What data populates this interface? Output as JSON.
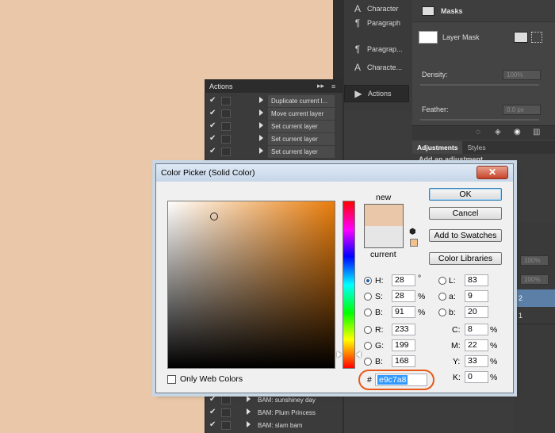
{
  "colors": {
    "background": "#e9c7a8",
    "new_color": "#e9c7a8",
    "current_color": "#e6e6e6",
    "accent_ring": "#e85a1c"
  },
  "ps_mid_panel": [
    {
      "icon": "A",
      "label": "Character"
    },
    {
      "icon": "¶",
      "label": "Paragraph"
    },
    {
      "icon": "¶",
      "label": "Paragrap..."
    },
    {
      "icon": "A",
      "label": "Characte..."
    },
    {
      "icon": "▶",
      "label": "Actions"
    }
  ],
  "masks": {
    "title": "Masks",
    "layer_mask": "Layer Mask",
    "density_label": "Density:",
    "density_value": "100%",
    "feather_label": "Feather:",
    "feather_value": "0.0 px"
  },
  "adjustments": {
    "tab1": "Adjustments",
    "tab2": "Styles",
    "hint": "Add an adjustment"
  },
  "layers_right": {
    "opacity1": "100%",
    "opacity2": "100%",
    "row1": "2",
    "row2": "1"
  },
  "actions_panel": {
    "title": "Actions",
    "top_rows": [
      "Duplicate current l...",
      "Move current layer",
      "Set current layer",
      "Set current layer",
      "Set current layer"
    ],
    "bottom_rows": [
      "BAM: sunshiney day",
      "BAM: Plum Princess",
      "BAM: slam bam"
    ]
  },
  "dialog": {
    "title": "Color Picker (Solid Color)",
    "close": "✕",
    "new_label": "new",
    "current_label": "current",
    "buttons": {
      "ok": "OK",
      "cancel": "Cancel",
      "add_swatches": "Add to Swatches",
      "libraries": "Color Libraries"
    },
    "hsb": {
      "h": "28",
      "s": "28",
      "b": "91",
      "h_unit": "°",
      "s_unit": "%",
      "b_unit": "%"
    },
    "rgb": {
      "r": "233",
      "g": "199",
      "b": "168"
    },
    "lab": {
      "l": "83",
      "a": "9",
      "b": "20"
    },
    "cmyk": {
      "c": "8",
      "m": "22",
      "y": "33",
      "k": "0",
      "unit": "%"
    },
    "labels": {
      "h": "H:",
      "s": "S:",
      "b": "B:",
      "r": "R:",
      "g": "G:",
      "b2": "B:",
      "l": "L:",
      "a": "a:",
      "lb": "b:",
      "c": "C:",
      "m": "M:",
      "y": "Y:",
      "k": "K:"
    },
    "hex_prefix": "#",
    "hex": "e9c7a8",
    "web_colors_label": "Only Web Colors"
  }
}
